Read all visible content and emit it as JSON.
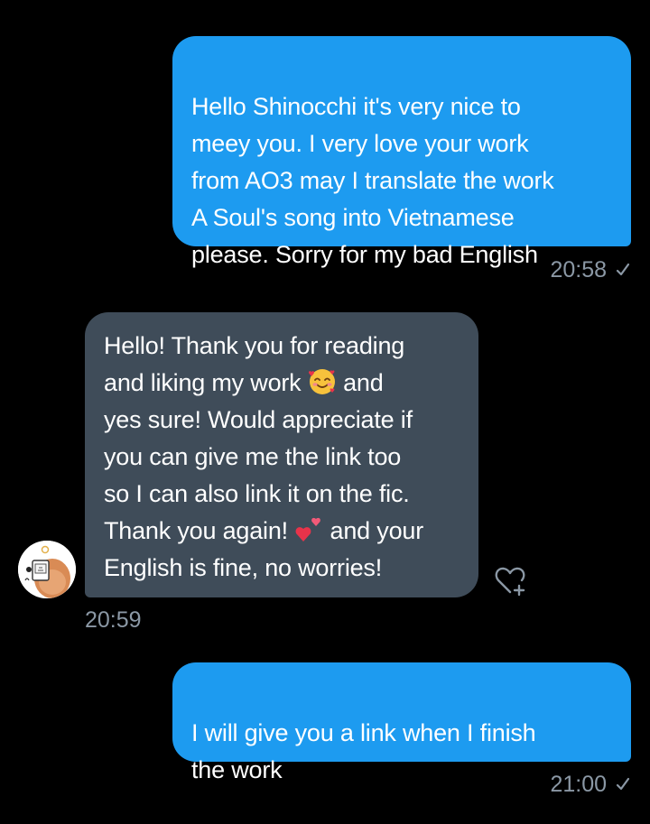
{
  "conversation": {
    "messages": [
      {
        "direction": "outgoing",
        "text": "Hello Shinocchi it's very nice to\nmeey you. I very love your work\nfrom AO3 may I translate the work\nA Soul's song into Vietnamese\nplease. Sorry for my bad English",
        "time": "20:58",
        "status_icon": "sent-check-icon"
      },
      {
        "direction": "incoming",
        "parts": {
          "a": "Hello! Thank you for reading\nand liking my work ",
          "emoji1": "smiling-face-with-hearts-emoji",
          "b": " and\nyes sure! Would appreciate if\nyou can give me the link too\nso I can also link it on the fic.\nThank you again! ",
          "emoji2": "two-hearts-emoji",
          "c": " and your\nEnglish is fine, no worries!"
        },
        "time": "20:59",
        "avatar_icon": "user-avatar",
        "reaction_icon": "add-reaction-heart-icon"
      },
      {
        "direction": "outgoing",
        "text": "I will give you a link when I finish\nthe work",
        "time": "21:00",
        "status_icon": "sent-check-icon"
      }
    ]
  },
  "colors": {
    "background": "#000000",
    "outgoing_bubble": "#1d9bf0",
    "incoming_bubble": "#3f4c59",
    "timestamp": "#8b98a5",
    "text": "#ffffff"
  }
}
